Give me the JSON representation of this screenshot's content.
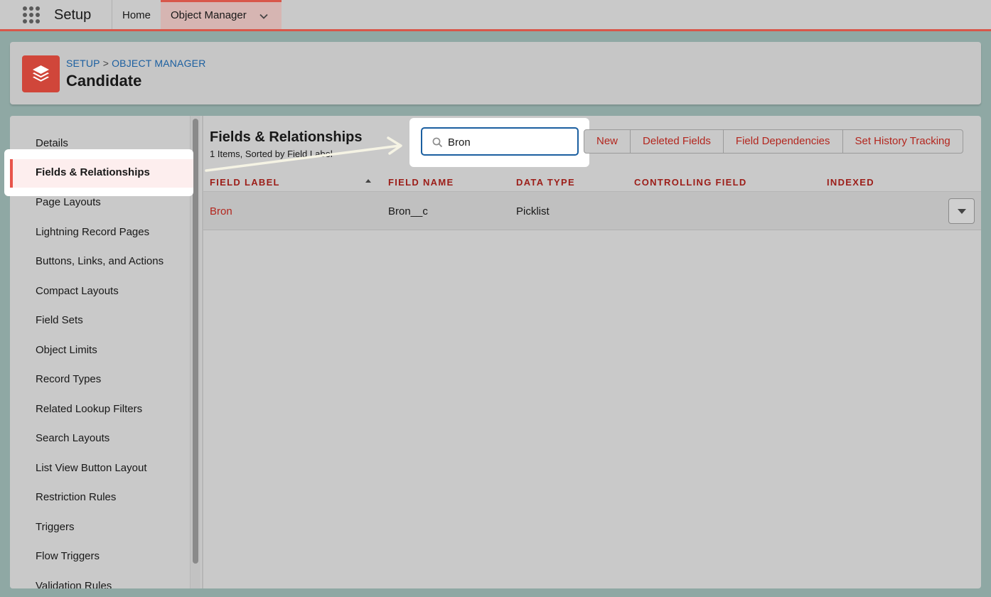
{
  "topnav": {
    "app_name": "Setup",
    "home_label": "Home",
    "active_tab_label": "Object Manager"
  },
  "header": {
    "breadcrumb_setup": "SETUP",
    "breadcrumb_separator": ">",
    "breadcrumb_object_manager": "OBJECT MANAGER",
    "title": "Candidate"
  },
  "sidebar": {
    "items": [
      {
        "label": "Details"
      },
      {
        "label": "Fields & Relationships",
        "active": true
      },
      {
        "label": "Page Layouts"
      },
      {
        "label": "Lightning Record Pages"
      },
      {
        "label": "Buttons, Links, and Actions"
      },
      {
        "label": "Compact Layouts"
      },
      {
        "label": "Field Sets"
      },
      {
        "label": "Object Limits"
      },
      {
        "label": "Record Types"
      },
      {
        "label": "Related Lookup Filters"
      },
      {
        "label": "Search Layouts"
      },
      {
        "label": "List View Button Layout"
      },
      {
        "label": "Restriction Rules"
      },
      {
        "label": "Triggers"
      },
      {
        "label": "Flow Triggers"
      },
      {
        "label": "Validation Rules"
      }
    ]
  },
  "main": {
    "title": "Fields & Relationships",
    "subtitle": "1 Items, Sorted by Field Label",
    "search_value": "Bron",
    "buttons": {
      "new": "New",
      "deleted_fields": "Deleted Fields",
      "field_dependencies": "Field Dependencies",
      "set_history_tracking": "Set History Tracking"
    },
    "table": {
      "headers": {
        "field_label": "FIELD LABEL",
        "field_name": "FIELD NAME",
        "data_type": "DATA TYPE",
        "controlling_field": "CONTROLLING FIELD",
        "indexed": "INDEXED"
      },
      "rows": [
        {
          "field_label": "Bron",
          "field_name": "Bron__c",
          "data_type": "Picklist",
          "controlling_field": "",
          "indexed": ""
        }
      ]
    }
  },
  "colors": {
    "accent_red": "#d8574a",
    "link_red": "#b3261e",
    "link_blue": "#1b5fa0",
    "object_icon": "#d0463a"
  },
  "icons": {
    "app_launcher": "app-launcher-grid-icon",
    "tab_chevron": "chevron-down-icon",
    "object": "layers-stack-icon",
    "search": "search-icon",
    "sort": "sort-ascending-icon",
    "row_action": "dropdown-caret-icon"
  }
}
